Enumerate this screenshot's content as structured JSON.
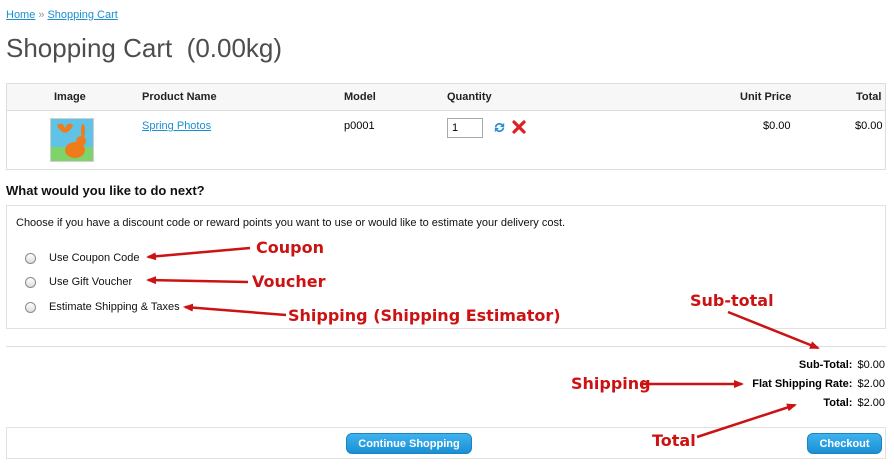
{
  "breadcrumb": {
    "home": "Home",
    "separator": "»",
    "current": "Shopping Cart"
  },
  "page_title": "Shopping Cart  (0.00kg)",
  "cart": {
    "headers": {
      "image": "Image",
      "product_name": "Product Name",
      "model": "Model",
      "quantity": "Quantity",
      "unit_price": "Unit Price",
      "total": "Total"
    },
    "items": [
      {
        "product_name": "Spring Photos",
        "model": "p0001",
        "quantity": "1",
        "unit_price": "$0.00",
        "total": "$0.00",
        "thumbnail_icon": "bunny-butterfly-image"
      }
    ]
  },
  "next": {
    "heading": "What would you like to do next?",
    "description": "Choose if you have a discount code or reward points you want to use or would like to estimate your delivery cost.",
    "options": [
      {
        "label": "Use Coupon Code"
      },
      {
        "label": "Use Gift Voucher"
      },
      {
        "label": "Estimate Shipping & Taxes"
      }
    ]
  },
  "totals": [
    {
      "label": "Sub-Total:",
      "value": "$0.00"
    },
    {
      "label": "Flat Shipping Rate:",
      "value": "$2.00"
    },
    {
      "label": "Total:",
      "value": "$2.00"
    }
  ],
  "buttons": {
    "continue": "Continue Shopping",
    "checkout": "Checkout"
  },
  "annotations": {
    "coupon": "Coupon",
    "voucher": "Voucher",
    "shipping_estimator": "Shipping (Shipping Estimator)",
    "subtotal": "Sub-total",
    "shipping": "Shipping",
    "total": "Total"
  },
  "colors": {
    "link": "#1b8fd0",
    "button": "#1a8fd4",
    "annotation": "#cc1212",
    "title": "#4d4d4d"
  }
}
